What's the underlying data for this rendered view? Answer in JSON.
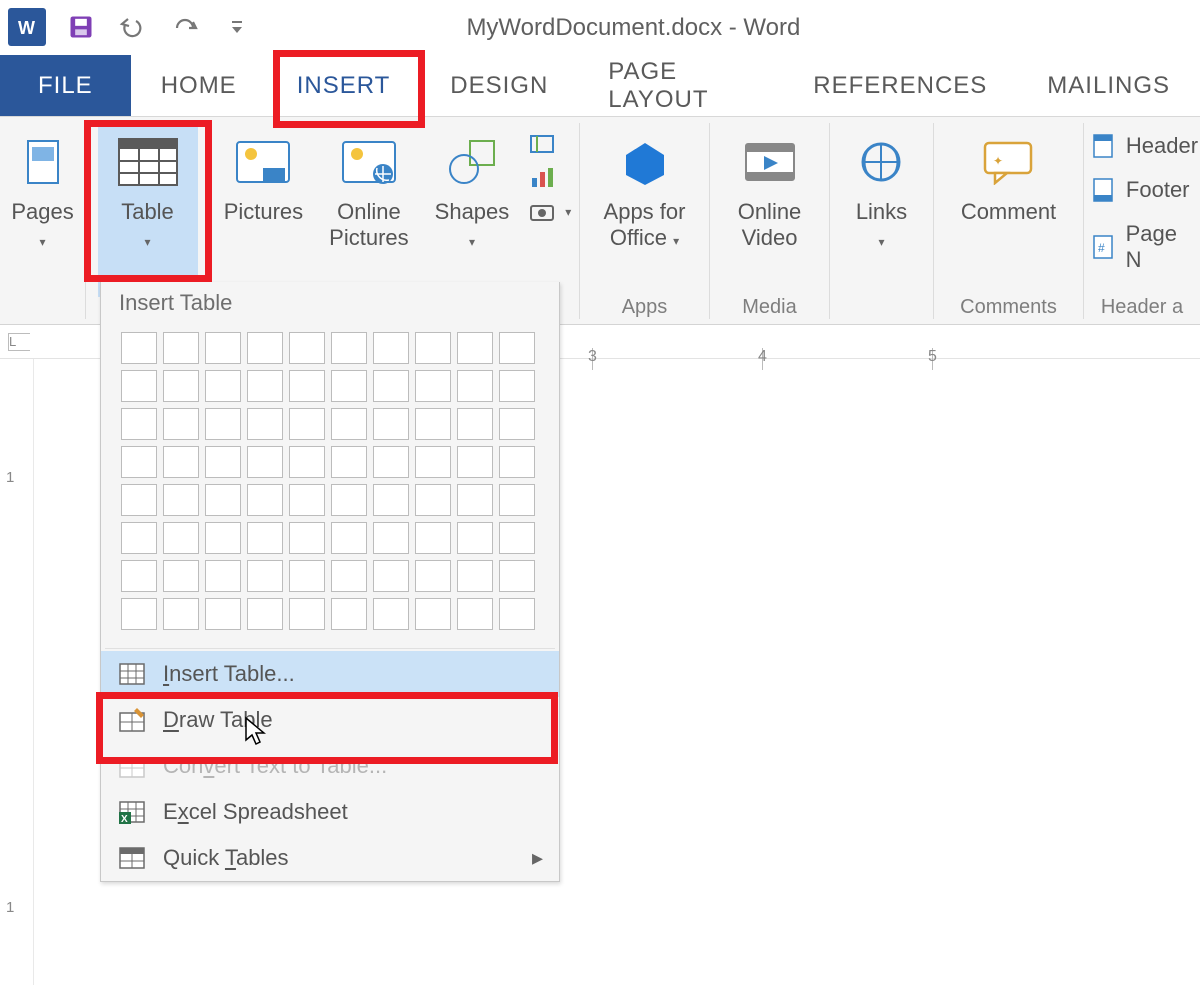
{
  "title": "MyWordDocument.docx - Word",
  "tabs": {
    "file": "FILE",
    "home": "HOME",
    "insert": "INSERT",
    "design": "DESIGN",
    "layout": "PAGE LAYOUT",
    "refs": "REFERENCES",
    "mail": "MAILINGS"
  },
  "ribbon": {
    "pages_label": "Pages",
    "table_label": "Table",
    "pictures_label": "Pictures",
    "online_pics_1": "Online",
    "online_pics_2": "Pictures",
    "shapes_label": "Shapes",
    "apps_label_1": "Apps for",
    "apps_label_2": "Office",
    "apps_group": "Apps",
    "video_label_1": "Online",
    "video_label_2": "Video",
    "media_group": "Media",
    "links_label": "Links",
    "comment_label": "Comment",
    "comments_group": "Comments",
    "hf_group": "Header a",
    "hf_items": {
      "header": "Header",
      "footer": "Footer",
      "page_no": "Page N"
    }
  },
  "dropdown": {
    "title": "Insert Table",
    "grid_cols": 10,
    "grid_rows": 8,
    "items": {
      "insert": "Insert Table...",
      "draw": "Draw Table",
      "convert": "Convert Text to Table...",
      "excel": "Excel Spreadsheet",
      "quick": "Quick Tables"
    }
  },
  "ruler": {
    "t3": "3",
    "t4": "4",
    "t5": "5"
  },
  "vruler": {
    "one": "1"
  }
}
